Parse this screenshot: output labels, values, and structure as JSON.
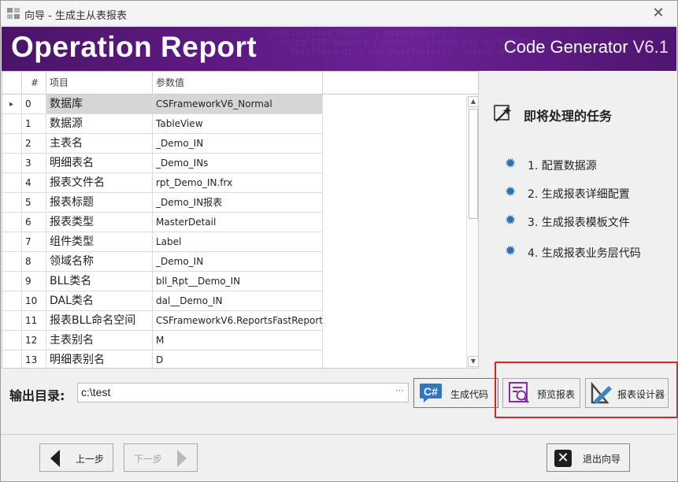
{
  "window": {
    "title": "向导 - 生成主从表报表",
    "close_glyph": "✕"
  },
  "banner": {
    "heading": "Operation Report",
    "product": "Code Generator",
    "version": "V6.1"
  },
  "grid": {
    "columns": [
      "#",
      "项目",
      "参数值"
    ],
    "selected_row": 0,
    "rows": [
      {
        "no": "0",
        "item": "数据库",
        "value": "CSFrameworkV6_Normal"
      },
      {
        "no": "1",
        "item": "数据源",
        "value": "TableView"
      },
      {
        "no": "2",
        "item": "主表名",
        "value": "_Demo_IN"
      },
      {
        "no": "3",
        "item": "明细表名",
        "value": "_Demo_INs"
      },
      {
        "no": "4",
        "item": "报表文件名",
        "value": "rpt_Demo_IN.frx"
      },
      {
        "no": "5",
        "item": "报表标题",
        "value": "_Demo_IN报表"
      },
      {
        "no": "6",
        "item": "报表类型",
        "value": "MasterDetail"
      },
      {
        "no": "7",
        "item": "组件类型",
        "value": "Label"
      },
      {
        "no": "8",
        "item": "领域名称",
        "value": "_Demo_IN"
      },
      {
        "no": "9",
        "item": "BLL类名",
        "value": "bll_Rpt__Demo_IN"
      },
      {
        "no": "10",
        "item": "DAL类名",
        "value": "dal__Demo_IN"
      },
      {
        "no": "11",
        "item": "报表BLL命名空间",
        "value": "CSFrameworkV6.ReportsFastReport"
      },
      {
        "no": "12",
        "item": "主表别名",
        "value": "M"
      },
      {
        "no": "13",
        "item": "明细表别名",
        "value": "D"
      }
    ]
  },
  "tasks": {
    "title": "即将处理的任务",
    "items": [
      "1. 配置数据源",
      "2. 生成报表详细配置",
      "3. 生成报表模板文件",
      "4. 生成报表业务层代码"
    ]
  },
  "output": {
    "label": "输出目录:",
    "value": "c:\\test",
    "browse_glyph": "···"
  },
  "buttons": {
    "generate": "生成代码",
    "preview": "预览报表",
    "designer": "报表设计器",
    "back": "上一步",
    "next": "下一步",
    "exit": "退出向导"
  },
  "colors": {
    "banner": "#5e1b84",
    "highlight": "#e8201c",
    "task_icon": "#2e6fb8",
    "selected_row": "#d6d6d6"
  },
  "icons": {
    "app": "app-icon",
    "task": "gear-icon",
    "tasks_header": "wand-icon",
    "generate": "csharp-icon",
    "preview": "report-preview-icon",
    "designer": "report-design-icon",
    "exit": "close-icon"
  }
}
